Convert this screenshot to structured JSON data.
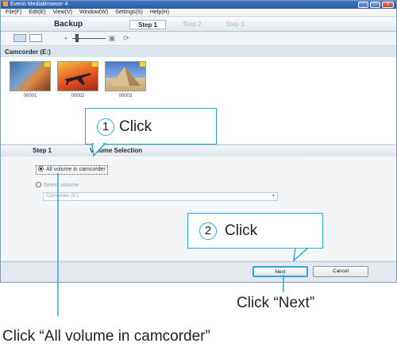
{
  "window": {
    "title": "Everio MediaBrowser 4",
    "menu": [
      "File(F)",
      "Edit(E)",
      "View(V)",
      "Window(W)",
      "Settings(S)",
      "Help(H)"
    ]
  },
  "stepbar": {
    "title": "Backup",
    "steps": [
      "Step 1",
      "Step 2",
      "Step 3"
    ]
  },
  "source": {
    "label": "Camcorder (E:)",
    "thumbnails": [
      {
        "label": "00001"
      },
      {
        "label": "00002"
      },
      {
        "label": "00003"
      }
    ]
  },
  "step_header": {
    "step": "Step 1",
    "title": "Volume Selection"
  },
  "options": {
    "all_volume": "All volume in camcorder",
    "select_volume": "Select volume",
    "dropdown_value": "Camcorder (E:)"
  },
  "footer": {
    "next": "Next",
    "cancel": "Cancel"
  },
  "callouts": {
    "one": {
      "num": "1",
      "text": "Click"
    },
    "two": {
      "num": "2",
      "text": "Click"
    }
  },
  "captions": {
    "next": "Click “Next”",
    "all_volume": "Click “All volume in camcorder”"
  },
  "colors": {
    "callout_border": "#29a8de",
    "titlebar": "#2a5aa5"
  }
}
